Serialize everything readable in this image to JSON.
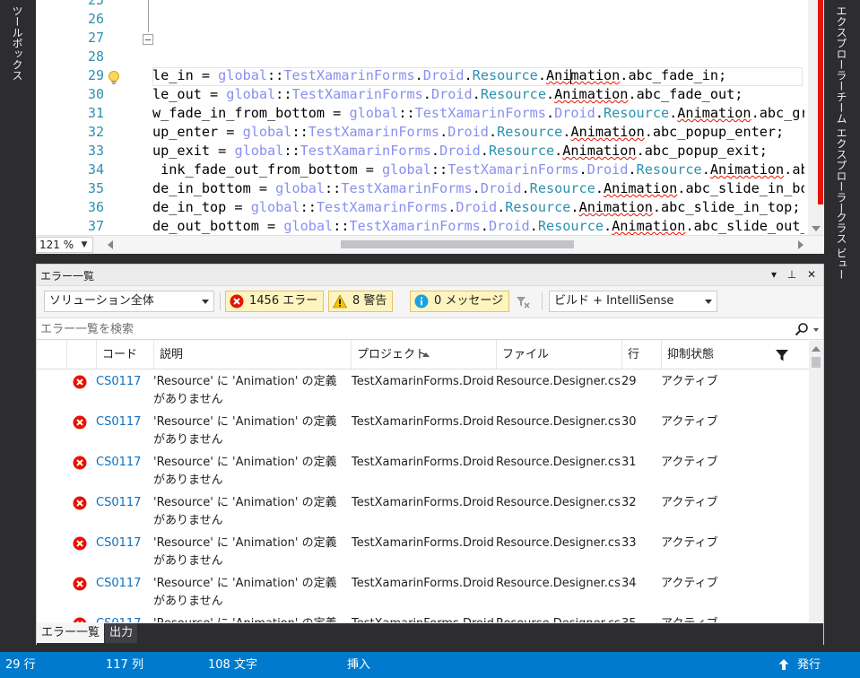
{
  "left_strip": {
    "toolbox_label": "ツールボックス"
  },
  "right_strip": {
    "tabs": [
      "エクスプローラー",
      "チーム エクスプローラー",
      "クラス ビュー"
    ]
  },
  "editor": {
    "line_numbers": [
      "25",
      "26",
      "27",
      "28",
      "29",
      "30",
      "31",
      "32",
      "33",
      "34",
      "35",
      "36",
      "37"
    ],
    "zoom": "121 %",
    "lines": [
      {
        "prefix": "le_in = ",
        "member": "abc_fade_in;"
      },
      {
        "prefix": "le_out = ",
        "member": "abc_fade_out;"
      },
      {
        "prefix": "w_fade_in_from_bottom = ",
        "member": "abc_grow_fade_in_from_bottom;"
      },
      {
        "prefix": "up_enter = ",
        "member": "abc_popup_enter;"
      },
      {
        "prefix": "up_exit = ",
        "member": "abc_popup_exit;"
      },
      {
        "prefix": " ink_fade_out_from_bottom = ",
        "member": "abc_shrink_fade_out_from_bottom;"
      },
      {
        "prefix": "de_in_bottom = ",
        "member": "abc_slide_in_bottom;"
      },
      {
        "prefix": "de_in_top = ",
        "member": "abc_slide_in_top;"
      },
      {
        "prefix": "de_out_bottom = ",
        "member": "abc_slide_out_bottom;"
      }
    ],
    "tokens": {
      "global": "global",
      "sep": "::",
      "ns1": "TestXamarinForms",
      "ns2": "Droid",
      "type": "Resource",
      "anim": "Animation",
      "dot": "."
    }
  },
  "error_list": {
    "title": "エラー一覧",
    "scope": "ソリューション全体",
    "errors_label": "1456 エラー",
    "warnings_label": "8 警告",
    "messages_label": "0 メッセージ",
    "build_filter": "ビルド + IntelliSense",
    "search_placeholder": "エラー一覧を検索",
    "columns": {
      "code": "コード",
      "description": "説明",
      "project": "プロジェクト",
      "file": "ファイル",
      "line": "行",
      "suppression": "抑制状態"
    },
    "rows": [
      {
        "code": "CS0117",
        "description": "'Resource' に 'Animation' の定義がありません",
        "project": "TestXamarinForms.Droid",
        "file": "Resource.Designer.cs",
        "line": "29",
        "state": "アクティブ"
      },
      {
        "code": "CS0117",
        "description": "'Resource' に 'Animation' の定義がありません",
        "project": "TestXamarinForms.Droid",
        "file": "Resource.Designer.cs",
        "line": "30",
        "state": "アクティブ"
      },
      {
        "code": "CS0117",
        "description": "'Resource' に 'Animation' の定義がありません",
        "project": "TestXamarinForms.Droid",
        "file": "Resource.Designer.cs",
        "line": "31",
        "state": "アクティブ"
      },
      {
        "code": "CS0117",
        "description": "'Resource' に 'Animation' の定義がありません",
        "project": "TestXamarinForms.Droid",
        "file": "Resource.Designer.cs",
        "line": "32",
        "state": "アクティブ"
      },
      {
        "code": "CS0117",
        "description": "'Resource' に 'Animation' の定義がありません",
        "project": "TestXamarinForms.Droid",
        "file": "Resource.Designer.cs",
        "line": "33",
        "state": "アクティブ"
      },
      {
        "code": "CS0117",
        "description": "'Resource' に 'Animation' の定義がありません",
        "project": "TestXamarinForms.Droid",
        "file": "Resource.Designer.cs",
        "line": "34",
        "state": "アクティブ"
      },
      {
        "code": "CS0117",
        "description": "'Resource' に 'Animation' の定義がありません",
        "project": "TestXamarinForms.Droid",
        "file": "Resource.Designer.cs",
        "line": "35",
        "state": "アクティブ"
      }
    ],
    "tabs": {
      "error_list": "エラー一覧",
      "output": "出力"
    }
  },
  "status_bar": {
    "line": "29 行",
    "column": "117 列",
    "chars": "108 文字",
    "mode": "挿入",
    "publish": "発行"
  },
  "colors": {
    "accent": "#007acc",
    "error": "#e51400",
    "warning_bg": "#fdf4bf",
    "code_link": "#0e70c0"
  }
}
